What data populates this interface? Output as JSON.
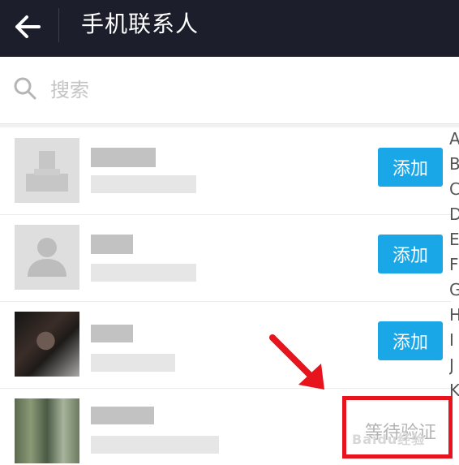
{
  "header": {
    "title": "手机联系人",
    "back_icon": "arrow-left-icon",
    "background_color": "#1c1f2b"
  },
  "search": {
    "placeholder": "搜索",
    "value": "",
    "icon": "search-icon"
  },
  "contacts": [
    {
      "avatar": "default-avatar",
      "action": "添加"
    },
    {
      "avatar": "default-avatar",
      "action": "添加"
    },
    {
      "avatar": "photo-avatar",
      "action": "添加"
    },
    {
      "avatar": "photo-avatar",
      "status": "等待验证"
    }
  ],
  "alphabet_index": [
    "A",
    "B",
    "C",
    "D",
    "E",
    "F",
    "G",
    "H",
    "I",
    "J",
    "K"
  ],
  "accent_color": "#1aa7e8",
  "annotation_color": "#e8141d",
  "watermark": "Baidu经验"
}
